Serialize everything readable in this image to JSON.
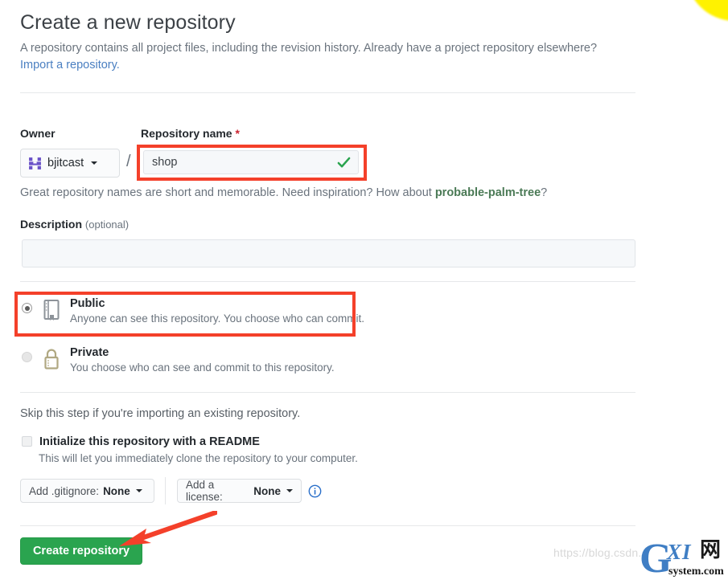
{
  "header": {
    "title": "Create a new repository",
    "description": "A repository contains all project files, including the revision history. Already have a project repository elsewhere?",
    "import_link": "Import a repository."
  },
  "owner_field": {
    "label": "Owner",
    "value": "bjitcast",
    "avatar_icon": "identicon-avatar",
    "caret_icon": "chevron-down-icon"
  },
  "repo_name_field": {
    "label": "Repository name",
    "required_marker": "*",
    "value": "shop",
    "valid_icon": "check-icon",
    "separator": "/",
    "hint_prefix": "Great repository names are short and memorable. Need inspiration? How about ",
    "hint_suggestion": "probable-palm-tree",
    "hint_suffix": "?"
  },
  "description_field": {
    "label": "Description",
    "optional_text": "(optional)",
    "value": "",
    "placeholder": ""
  },
  "visibility": {
    "options": [
      {
        "id": "public",
        "title": "Public",
        "description": "Anyone can see this repository. You choose who can commit.",
        "icon": "repo-book-icon",
        "selected": true
      },
      {
        "id": "private",
        "title": "Private",
        "description": "You choose who can see and commit to this repository.",
        "icon": "lock-icon",
        "selected": false
      }
    ]
  },
  "initialize": {
    "skip_note": "Skip this step if you're importing an existing repository.",
    "readme_label": "Initialize this repository with a README",
    "readme_sub": "This will let you immediately clone the repository to your computer.",
    "readme_checked": false,
    "gitignore_prefix": "Add .gitignore:",
    "gitignore_value": "None",
    "license_prefix": "Add a license:",
    "license_value": "None",
    "info_icon": "info-icon"
  },
  "submit": {
    "label": "Create repository"
  },
  "annotations": {
    "box_color": "#f4402a",
    "arrow_color": "#f4402a",
    "boxes": [
      "repo-name-field",
      "public-visibility-option"
    ],
    "arrow_target": "create-repository-button"
  },
  "watermark": {
    "url_text": "https://blog.csdn.",
    "logo_g": "G",
    "logo_xi": "XI",
    "logo_cn": "网",
    "logo_sub": "system.com"
  },
  "colors": {
    "accent_green": "#2aa44f",
    "annotation_red": "#f4402a",
    "link_blue": "#4a7fc1",
    "suggestion_green": "#4b7a56",
    "muted_text": "#6a737d"
  }
}
